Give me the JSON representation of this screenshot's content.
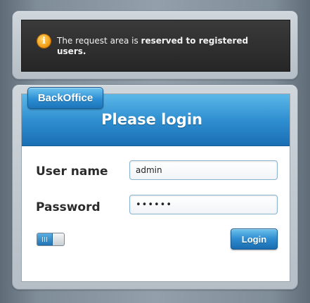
{
  "notice": {
    "icon": "info-icon",
    "icon_glyph": "i",
    "text_regular": "The request area is ",
    "text_bold": "reserved to registered users."
  },
  "login": {
    "tab_label": "BackOffice",
    "title": "Please login",
    "username_label": "User name",
    "username_value": "admin",
    "password_label": "Password",
    "password_value": "••••••",
    "remember_toggle": "on",
    "submit_label": "Login"
  },
  "colors": {
    "accent_blue": "#2f8fd0",
    "notice_background": "#2e2e2e",
    "info_icon": "#f3a31b"
  }
}
